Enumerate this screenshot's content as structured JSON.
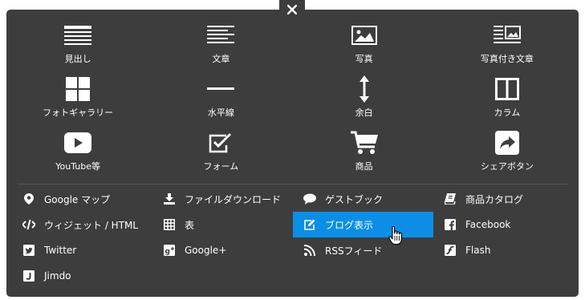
{
  "close_button": {
    "label": "✕",
    "icon": "close-icon"
  },
  "grid_items": [
    {
      "id": "heading",
      "label": "見出し",
      "icon": "heading-icon"
    },
    {
      "id": "text",
      "label": "文章",
      "icon": "text-icon"
    },
    {
      "id": "photo",
      "label": "写真",
      "icon": "photo-icon"
    },
    {
      "id": "photo-text",
      "label": "写真付き文章",
      "icon": "photo-text-icon"
    },
    {
      "id": "gallery",
      "label": "フォトギャラリー",
      "icon": "gallery-icon"
    },
    {
      "id": "hr",
      "label": "水平線",
      "icon": "horizontal-line-icon"
    },
    {
      "id": "spacer",
      "label": "余白",
      "icon": "spacer-icon"
    },
    {
      "id": "column",
      "label": "カラム",
      "icon": "column-icon"
    },
    {
      "id": "youtube",
      "label": "YouTube等",
      "icon": "play-icon"
    },
    {
      "id": "form",
      "label": "フォーム",
      "icon": "form-icon"
    },
    {
      "id": "product",
      "label": "商品",
      "icon": "cart-icon"
    },
    {
      "id": "share",
      "label": "シェアボタン",
      "icon": "share-icon"
    }
  ],
  "list_items": [
    {
      "id": "google-map",
      "label": "Google マップ",
      "icon": "map-pin-icon"
    },
    {
      "id": "download",
      "label": "ファイルダウンロード",
      "icon": "download-icon"
    },
    {
      "id": "guestbook",
      "label": "ゲストブック",
      "icon": "speech-bubble-icon"
    },
    {
      "id": "catalog",
      "label": "商品カタログ",
      "icon": "book-icon"
    },
    {
      "id": "widget",
      "label": "ウィジェット / HTML",
      "icon": "code-icon"
    },
    {
      "id": "table",
      "label": "表",
      "icon": "table-icon"
    },
    {
      "id": "blog",
      "label": "ブログ表示",
      "icon": "edit-icon",
      "active": true
    },
    {
      "id": "facebook",
      "label": "Facebook",
      "icon": "facebook-icon"
    },
    {
      "id": "twitter",
      "label": "Twitter",
      "icon": "twitter-icon"
    },
    {
      "id": "googleplus",
      "label": "Google+",
      "icon": "google-plus-icon"
    },
    {
      "id": "rss",
      "label": "RSSフィード",
      "icon": "rss-icon"
    },
    {
      "id": "flash",
      "label": "Flash",
      "icon": "flash-icon"
    },
    {
      "id": "jimdo",
      "label": "Jimdo",
      "icon": "jimdo-icon"
    }
  ],
  "colors": {
    "panel": "#3d3d3d",
    "active": "#0c8ee6",
    "text": "#ffffff",
    "divider": "#575757"
  }
}
